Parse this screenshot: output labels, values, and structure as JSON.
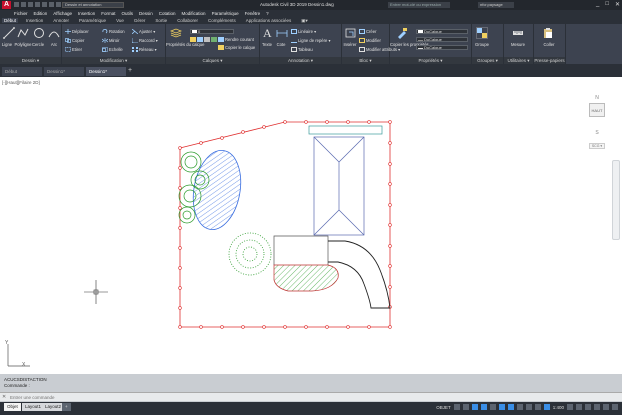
{
  "titlebar": {
    "logo": "A",
    "qat_title": "Dessin et annotation",
    "window_title": "Autodesk Civil 3D 2019  Dessin1.dwg",
    "search_placeholder": "Entrer mot-clé ou expression",
    "user": "nfcr.paysage",
    "controls": [
      "_",
      "□",
      "✕"
    ]
  },
  "menubar": [
    "Fichier",
    "Edition",
    "Affichage",
    "Insertion",
    "Format",
    "Outils",
    "Dessin",
    "Cotation",
    "Modification",
    "Paramétrique",
    "Fenêtre",
    "?"
  ],
  "ribbon_tabs": [
    "Début",
    "Insertion",
    "Annoter",
    "Paramétrique",
    "Vue",
    "Gérer",
    "Sortie",
    "Collaborer",
    "Compléments",
    "Applications associées",
    "▣▾"
  ],
  "active_ribbon_tab": "Début",
  "ribbon": {
    "dessin": {
      "label": "Dessin ▾",
      "ligne": "Ligne",
      "polyligne": "Polyligne",
      "cercle": "Cercle",
      "arc": "Arc"
    },
    "modification": {
      "label": "Modification ▾",
      "deplacer": "Déplacer",
      "rotation": "Rotation",
      "ajuster": "Ajuster ▾",
      "copier": "Copier",
      "miroir": "Miroir",
      "raccord": "Raccord ▾",
      "etirer": "Etirer",
      "echelle": "Echelle",
      "reseau": "Réseau ▾"
    },
    "calques": {
      "label": "Calques ▾",
      "proprietes": "Propriétés du calque",
      "layer_value": "0",
      "rendre_courant": "Rendre courant",
      "copier_calque": "Copier le calque"
    },
    "annotation": {
      "label": "Annotation ▾",
      "texte": "Texte",
      "cote": "Cote",
      "lineaire": "Linéaire ▾",
      "ligne_repere": "Ligne de repère ▾",
      "tableau": "Tableau"
    },
    "bloc": {
      "label": "Bloc ▾",
      "inserer": "Insérer",
      "creer": "Créer",
      "modifier": "Modifier",
      "modifier_attributs": "Modifier attributs ▾"
    },
    "proprietes": {
      "label": "Propriétés ▾",
      "copier_proprietes": "Copier les propriétés",
      "combo1": "DuCalque",
      "combo2": "DuCalque",
      "combo3": "DuCalque"
    },
    "groupes": {
      "label": "Groupes ▾",
      "groupe": "Groupe"
    },
    "utilitaires": {
      "label": "Utilitaires ▾",
      "mesure": "Mesure"
    },
    "presse_papiers": {
      "label": "Presse-papiers",
      "coller": "Coller"
    }
  },
  "doc_tabs": [
    "Début",
    "Dessin1*",
    "Dessin1*"
  ],
  "active_doc_tab_index": 2,
  "viewport_label": "[-][Haut][Filaire 2D]",
  "viewcube": {
    "north": "N",
    "face": "HAUT",
    "south": "S",
    "wcs": "SCG ▾"
  },
  "command": {
    "history_line1": "ACUCSDISTACTION",
    "history_line2": "Commande :",
    "placeholder": "Entrer une commande"
  },
  "layout_tabs": [
    "Objet",
    "Layout1",
    "Layout2",
    "+"
  ],
  "active_layout_index": 0,
  "status_bar": {
    "model_label": "OBJET",
    "scale": "1:400"
  },
  "colors": {
    "boundary": "#e03030",
    "trees": "#2a9a2a",
    "water": "#3a6ee0",
    "building": "#5a6ab0",
    "path": "#222222",
    "ribbon_bg": "#3d4350"
  }
}
